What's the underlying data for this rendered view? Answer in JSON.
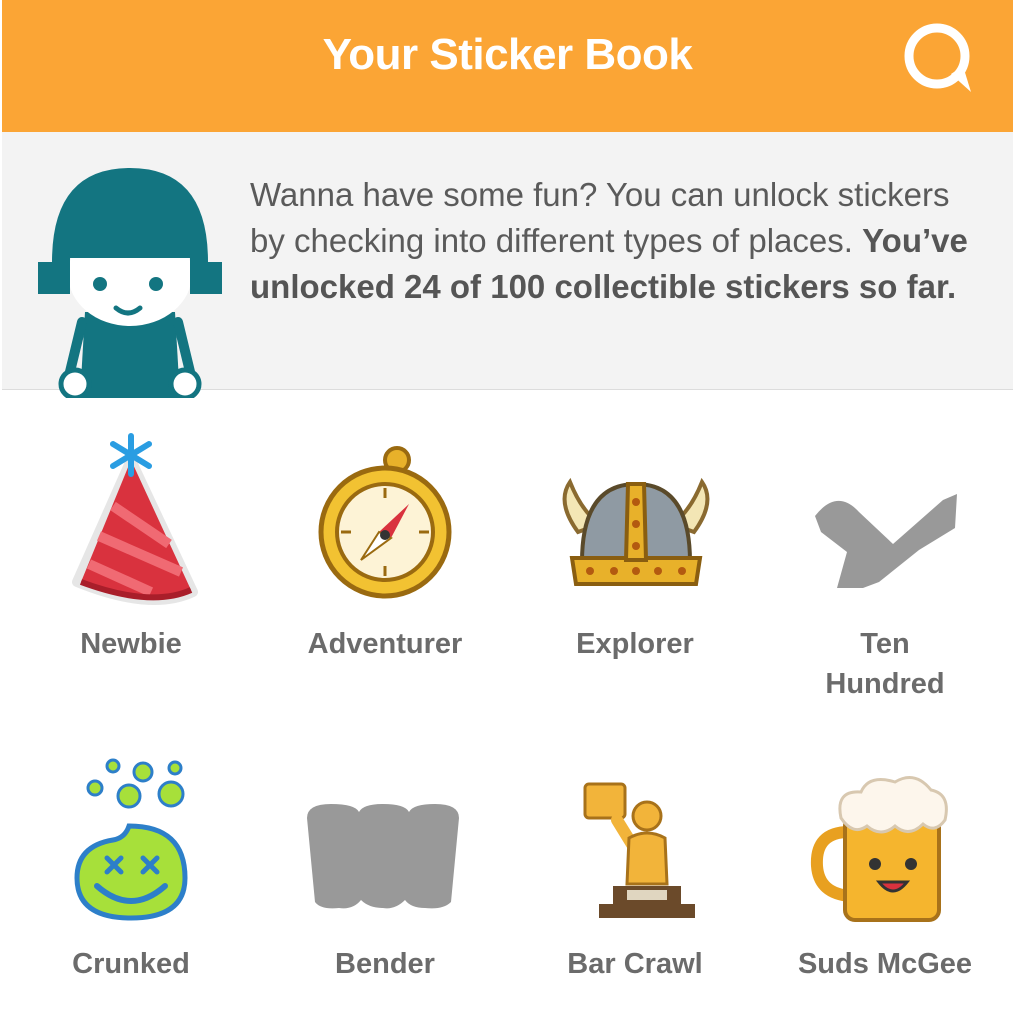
{
  "header": {
    "title": "Your Sticker Book",
    "chat_icon": "chat-bubble-icon",
    "accent": "#fba535"
  },
  "intro": {
    "text_plain": "Wanna have some fun? You can unlock stickers by checking into different types of places.",
    "text_bold": "You’ve unlocked 24 of 100 collectible stickers so far.",
    "unlocked": 24,
    "total": 100,
    "mascot_icon": "helmet-mascot-icon"
  },
  "stickers": [
    {
      "label": "Newbie",
      "icon": "party-hat-icon",
      "locked": false
    },
    {
      "label": "Adventurer",
      "icon": "compass-icon",
      "locked": false
    },
    {
      "label": "Explorer",
      "icon": "viking-helmet-icon",
      "locked": false
    },
    {
      "label": "Ten Hundred",
      "icon": "locked-silhouette-icon",
      "locked": true
    },
    {
      "label": "Crunked",
      "icon": "drunk-smiley-icon",
      "locked": false
    },
    {
      "label": "Bender",
      "icon": "locked-silhouette-icon",
      "locked": true
    },
    {
      "label": "Bar Crawl",
      "icon": "trophy-statue-icon",
      "locked": false
    },
    {
      "label": "Suds McGee",
      "icon": "beer-mug-icon",
      "locked": false
    }
  ]
}
